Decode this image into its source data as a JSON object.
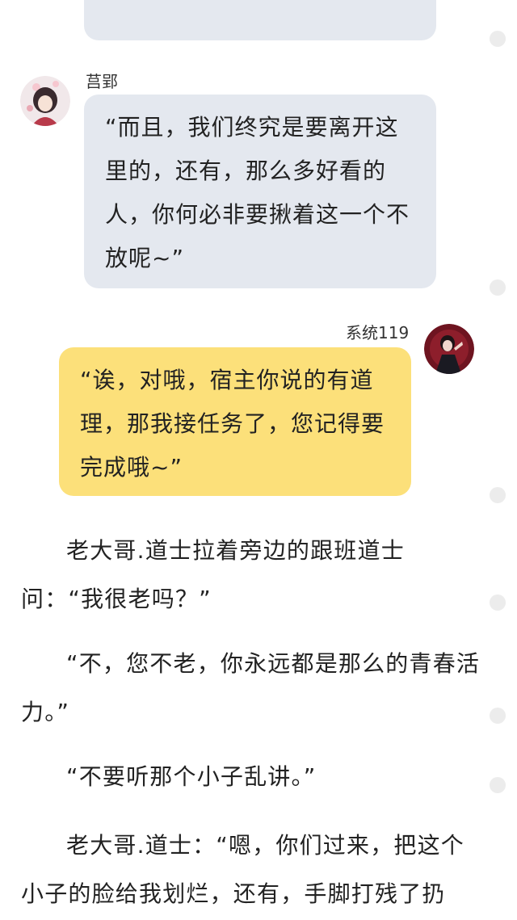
{
  "messages": [
    {
      "sender": "莒郢",
      "side": "left",
      "text": "“而且，我们终究是要离开这里的，还有，那么多好看的人，你何必非要揪着这一个不放呢~”"
    },
    {
      "sender": "系统119",
      "side": "right",
      "text": "“诶，对哦，宿主你说的有道理，那我接任务了，您记得要完成哦~”"
    }
  ],
  "paragraphs": [
    "老大哥.道士拉着旁边的跟班道士问：“我很老吗？”",
    "“不，您不老，你永远都是那么的青春活力。”",
    "“不要听那个小子乱讲。”",
    "老大哥.道士：“嗯，你们过来，把这个小子的脸给我划烂，还有，手脚打残了扔"
  ],
  "colors": {
    "left_bubble": "#e4e8ef",
    "right_bubble": "#fce07a",
    "marker": "#ececec"
  },
  "icons": [
    "avatar-left-girl",
    "avatar-right-boy"
  ]
}
